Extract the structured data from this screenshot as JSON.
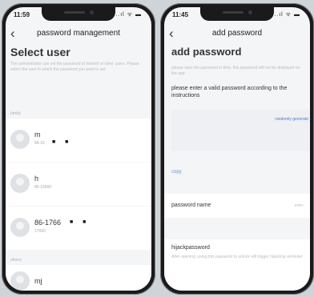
{
  "left_screen": {
    "status_time": "11:59",
    "status_icons": "..ıl ᯤ ▬",
    "back_icon": "‹",
    "title": "password management",
    "heading": "Select user",
    "notice": "The administrator can set the password of himself or other users. Please select the user to which the password you want to set.",
    "family_label": "family",
    "others_label": "others",
    "users": [
      {
        "name": "m",
        "phone": "86-15",
        "masks": "■ ■"
      },
      {
        "name": "h",
        "phone": "86-15660",
        "masks": ""
      },
      {
        "name": "86-1766",
        "phone": "17660",
        "masks": "■ ■"
      },
      {
        "name": "mj",
        "phone": "",
        "masks": ""
      }
    ]
  },
  "right_screen": {
    "status_time": "11:45",
    "status_icons": "..ıl ᯤ ▬",
    "back_icon": "‹",
    "title": "add password",
    "heading": "add password",
    "hint": "please save the password in time, this password will not be displayed on the app",
    "instruction": "please enter a valid password according to the instructions",
    "random_button": "randomly generate",
    "copy_label": "copy",
    "password_name_label": "password name",
    "password_name_value": "enter",
    "hijack_label": "hijackpassword",
    "hijack_desc": "After opening, using this password to unlock will trigger hijacking reminder"
  }
}
